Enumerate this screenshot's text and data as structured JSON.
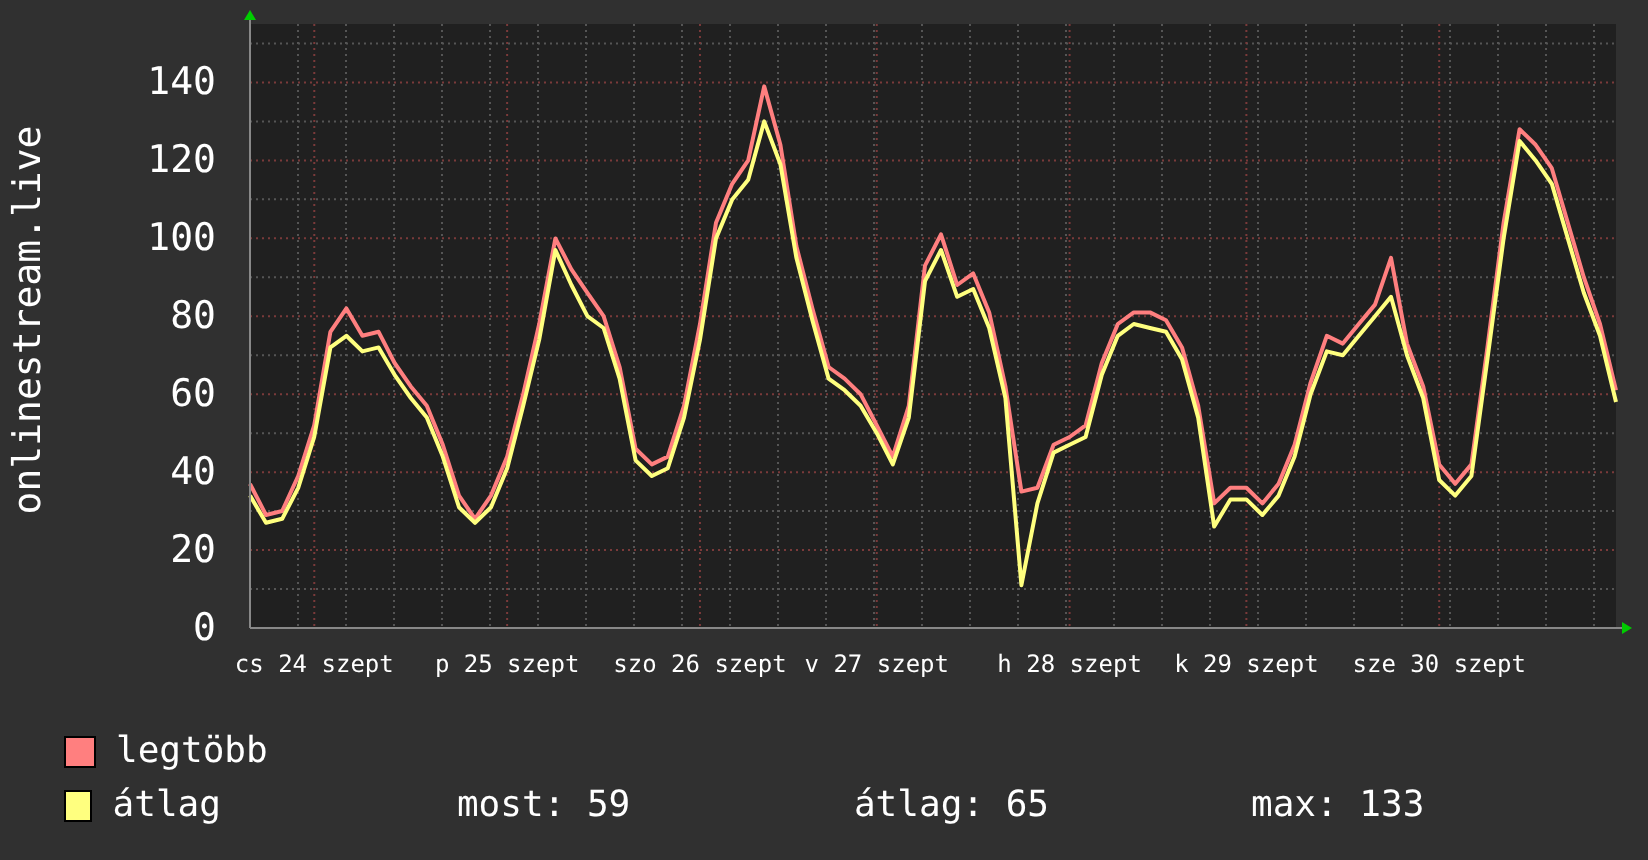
{
  "graph": {
    "chart_data": {
      "type": "line",
      "ylabel": "onlinestream.live",
      "categories": [
        null,
        null,
        null,
        null,
        "cs 24 szept",
        null,
        null,
        null,
        null,
        null,
        null,
        null,
        null,
        null,
        null,
        null,
        "p 25 szept",
        null,
        null,
        null,
        null,
        null,
        null,
        null,
        null,
        null,
        null,
        null,
        "szo 26 szept",
        null,
        null,
        null,
        null,
        null,
        null,
        null,
        null,
        null,
        null,
        "v 27 szept",
        null,
        null,
        null,
        null,
        null,
        null,
        null,
        null,
        null,
        null,
        null,
        "h 28 szept",
        null,
        null,
        null,
        null,
        null,
        null,
        null,
        null,
        null,
        null,
        "k 29 szept",
        null,
        null,
        null,
        null,
        null,
        null,
        null,
        null,
        null,
        null,
        null,
        "sze 30 szept",
        null,
        null,
        null,
        null,
        null,
        null,
        null,
        null,
        null,
        null,
        null
      ],
      "ylim": [
        0,
        155
      ],
      "grid": true,
      "yticks": [
        0,
        20,
        40,
        60,
        80,
        100,
        120,
        140
      ],
      "series": [
        {
          "name": "legtöbb",
          "color": "#ff7f7f",
          "values": [
            37,
            29,
            30,
            39,
            52,
            76,
            82,
            75,
            76,
            68,
            62,
            57,
            47,
            34,
            28,
            34,
            44,
            60,
            78,
            100,
            92,
            86,
            80,
            67,
            46,
            42,
            44,
            57,
            78,
            104,
            114,
            120,
            139,
            124,
            98,
            82,
            67,
            64,
            60,
            52,
            44,
            57,
            93,
            101,
            88,
            91,
            81,
            62,
            35,
            36,
            47,
            49,
            52,
            68,
            78,
            81,
            81,
            79,
            72,
            57,
            32,
            36,
            36,
            32,
            37,
            47,
            63,
            75,
            73,
            78,
            83,
            95,
            73,
            62,
            42,
            37,
            42,
            72,
            104,
            128,
            124,
            118,
            104,
            90,
            78,
            61
          ]
        },
        {
          "name": "átlag",
          "color": "#ffff7f",
          "values": [
            34,
            27,
            28,
            36,
            49,
            72,
            75,
            71,
            72,
            65,
            59,
            54,
            44,
            31,
            27,
            31,
            41,
            57,
            74,
            97,
            88,
            80,
            77,
            64,
            43,
            39,
            41,
            54,
            74,
            100,
            110,
            115,
            130,
            119,
            95,
            79,
            64,
            61,
            57,
            50,
            42,
            54,
            89,
            97,
            85,
            87,
            77,
            59,
            11,
            32,
            45,
            47,
            49,
            65,
            75,
            78,
            77,
            76,
            69,
            54,
            26,
            33,
            33,
            29,
            34,
            44,
            60,
            71,
            70,
            75,
            80,
            85,
            70,
            59,
            38,
            34,
            39,
            69,
            100,
            125,
            120,
            114,
            100,
            86,
            75,
            58
          ]
        }
      ]
    }
  },
  "legend_stats": [
    "most: 59",
    "átlag: 65",
    "max: 133"
  ]
}
